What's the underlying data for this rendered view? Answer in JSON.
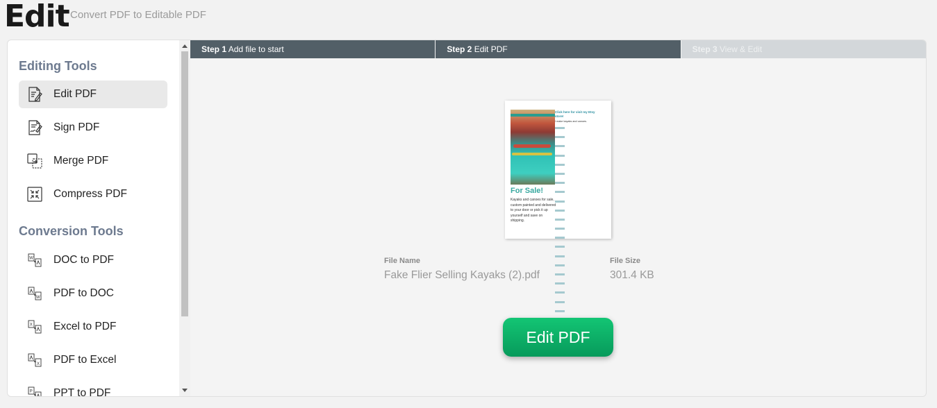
{
  "header": {
    "title": "Edit",
    "subtitle": "Convert PDF to Editable PDF"
  },
  "sidebar": {
    "editing_title": "Editing Tools",
    "editing_tools": [
      {
        "label": "Edit PDF",
        "icon": "edit-pdf-icon",
        "active": true
      },
      {
        "label": "Sign PDF",
        "icon": "sign-pdf-icon"
      },
      {
        "label": "Merge PDF",
        "icon": "merge-pdf-icon"
      },
      {
        "label": "Compress PDF",
        "icon": "compress-pdf-icon"
      }
    ],
    "conversion_title": "Conversion Tools",
    "conversion_tools": [
      {
        "label": "DOC to PDF",
        "icon": "doc-to-pdf-icon"
      },
      {
        "label": "PDF to DOC",
        "icon": "pdf-to-doc-icon"
      },
      {
        "label": "Excel to PDF",
        "icon": "excel-to-pdf-icon"
      },
      {
        "label": "PDF to Excel",
        "icon": "pdf-to-excel-icon"
      },
      {
        "label": "PPT to PDF",
        "icon": "ppt-to-pdf-icon"
      }
    ]
  },
  "steps": [
    {
      "num": "Step 1",
      "label": "Add file to start",
      "state": "done"
    },
    {
      "num": "Step 2",
      "label": "Edit PDF",
      "state": "current"
    },
    {
      "num": "Step 3",
      "label": "View & Edit",
      "state": "todo"
    }
  ],
  "preview": {
    "headline": "For Sale!",
    "description": "Kayaks and canoes for sale, custom painted and delivered to your door or pick it up yourself and save on shipping.",
    "side_heading": "Click here for visit my Etsy store!",
    "side_sub": "I make kayaks and canoes."
  },
  "file": {
    "name_label": "File Name",
    "name": "Fake Flier Selling Kayaks (2).pdf",
    "size_label": "File Size",
    "size": "301.4 KB"
  },
  "action": {
    "edit_button": "Edit PDF"
  },
  "colors": {
    "accent_green": "#0fae67",
    "step_dark": "#525f67",
    "step_light": "#d3d7da",
    "section_title": "#6d7a8f"
  }
}
